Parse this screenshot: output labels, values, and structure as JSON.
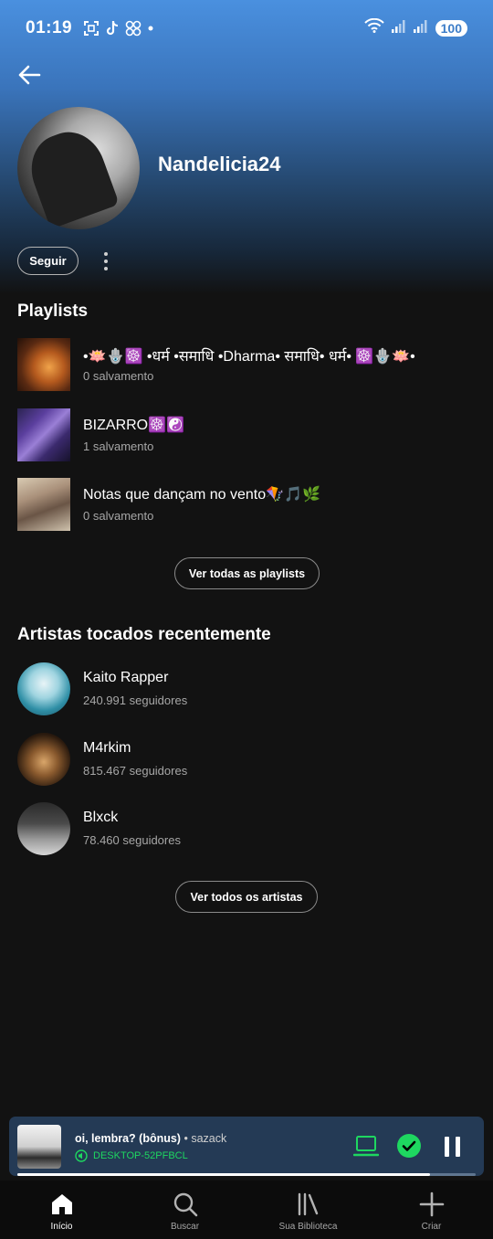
{
  "status_bar": {
    "time": "01:19",
    "left_icons": [
      "screenshot-icon",
      "tiktok-icon",
      "pinwheel-icon",
      "dot-icon"
    ],
    "battery": "100"
  },
  "profile": {
    "name": "Nandelicia24",
    "follow_label": "Seguir"
  },
  "playlists": {
    "title": "Playlists",
    "items": [
      {
        "title": "•🪷🪬☸️ •धर्म •समाधि •Dharma• समाधि• धर्म• ☸️🪬🪷•",
        "subtitle": "0 salvamento"
      },
      {
        "title": "BIZARRO☸️☯️",
        "subtitle": "1 salvamento"
      },
      {
        "title": "Notas que dançam no vento🪁🎵🌿",
        "subtitle": "0 salvamento"
      }
    ],
    "see_all_label": "Ver todas as playlists"
  },
  "artists": {
    "title": "Artistas tocados recentemente",
    "items": [
      {
        "name": "Kaito Rapper",
        "followers": "240.991 seguidores"
      },
      {
        "name": "M4rkim",
        "followers": "815.467 seguidores"
      },
      {
        "name": "Blxck",
        "followers": "78.460 seguidores"
      }
    ],
    "see_all_label": "Ver todos os artistas"
  },
  "now_playing": {
    "title": "oi, lembra? (bônus)",
    "separator": " • ",
    "artist": "sazack",
    "device": "DESKTOP-52PFBCL",
    "progress": 0.9
  },
  "bottom_nav": [
    {
      "label": "Início",
      "icon": "home-icon",
      "active": true
    },
    {
      "label": "Buscar",
      "icon": "search-icon",
      "active": false
    },
    {
      "label": "Sua Biblioteca",
      "icon": "library-icon",
      "active": false
    },
    {
      "label": "Criar",
      "icon": "plus-icon",
      "active": false
    }
  ],
  "colors": {
    "accent": "#1ed760",
    "background": "#121212",
    "header": "#4a90df",
    "player": "#243a55"
  }
}
